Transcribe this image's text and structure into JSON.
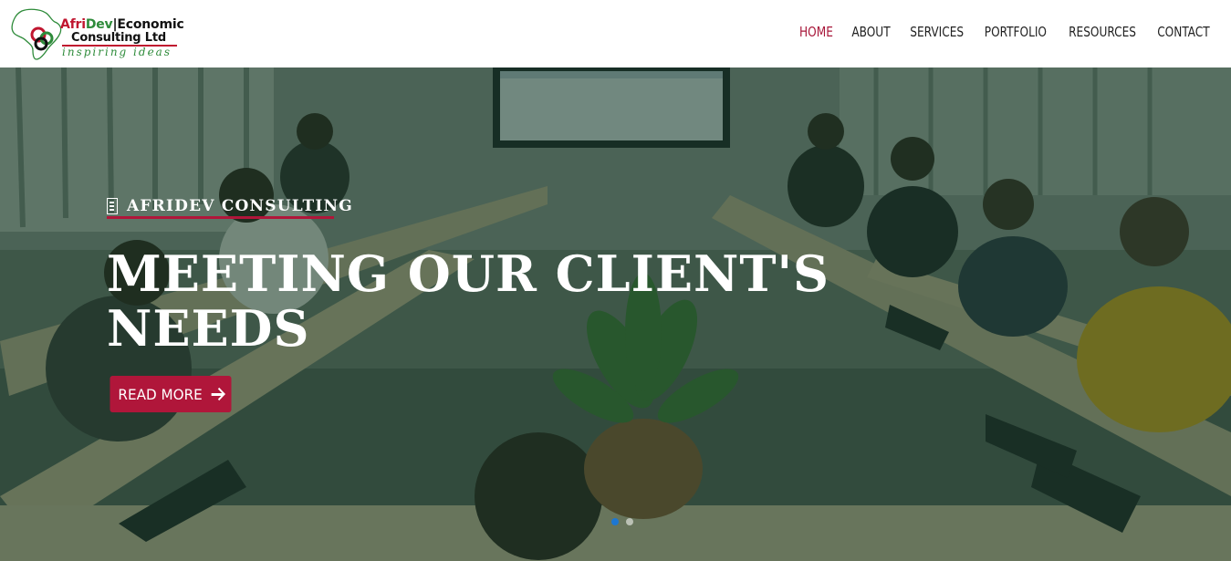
{
  "header": {
    "logo": {
      "line1_afri": "Afri",
      "line1_dev": "Dev",
      "line1_rest": "|Economic",
      "line2": "Consulting Ltd",
      "tagline": "inspiring ideas"
    },
    "nav": [
      {
        "label": "HOME",
        "active": true
      },
      {
        "label": "ABOUT",
        "active": false
      },
      {
        "label": "SERVICES",
        "active": false
      },
      {
        "label": "PORTFOLIO",
        "active": false
      },
      {
        "label": "RESOURCES",
        "active": false
      },
      {
        "label": "CONTACT",
        "active": false
      }
    ]
  },
  "hero": {
    "eyebrow_icon": "building-icon",
    "eyebrow": "AFRIDEV CONSULTING",
    "headline": "MEETING OUR CLIENT'S NEEDS",
    "cta_label": "READ MORE",
    "cta_icon": "arrow-right-icon",
    "slides_total": 2,
    "slide_active": 1
  },
  "colors": {
    "accent": "#b0163a",
    "nav_active": "#a8173a",
    "overlay": "#163a26",
    "dot_active": "#1d77d2"
  }
}
